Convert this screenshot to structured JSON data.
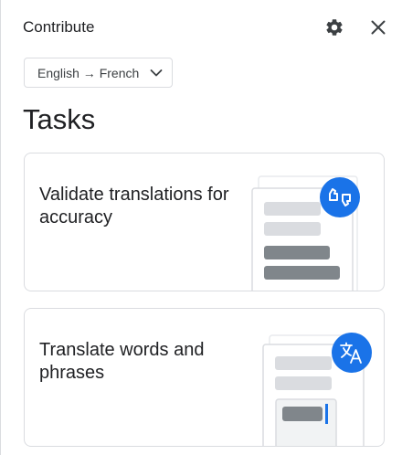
{
  "header": {
    "title": "Contribute",
    "settings_icon": "gear-icon",
    "close_icon": "close-icon"
  },
  "language_selector": {
    "value": "English → French",
    "icon": "chevron-down-icon"
  },
  "tasks": {
    "title": "Tasks",
    "cards": [
      {
        "label": "Validate translations for accuracy",
        "icon": "validate-icon"
      },
      {
        "label": "Translate words and phrases",
        "icon": "translate-icon"
      }
    ]
  },
  "colors": {
    "accent": "#1a73e8",
    "text": "#202124",
    "border": "#dadce0",
    "placeholder_light": "#dadce0",
    "placeholder_dark": "#80868b"
  }
}
